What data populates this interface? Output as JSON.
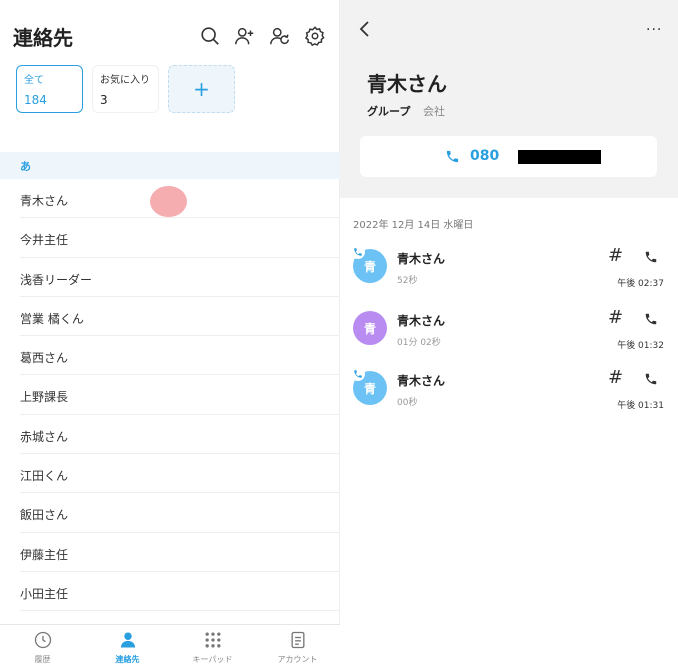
{
  "left": {
    "title": "連絡先",
    "header_icons": [
      "search-icon",
      "add-contact-icon",
      "sync-contacts-icon",
      "gear-icon"
    ],
    "cards": [
      {
        "label": "全て",
        "count": "184"
      },
      {
        "label": "お気に入り",
        "count": "3"
      },
      {
        "label": "+"
      }
    ],
    "section": "あ",
    "contacts": [
      "青木さん",
      "今井主任",
      "浅香リーダー",
      "営業 橘くん",
      "葛西さん",
      "上野課長",
      "赤城さん",
      "江田くん",
      "飯田さん",
      "伊藤主任",
      "小田主任"
    ]
  },
  "tabs": [
    {
      "label": "履歴",
      "icon": "clock-icon"
    },
    {
      "label": "連絡先",
      "icon": "person-icon"
    },
    {
      "label": "キーパッド",
      "icon": "keypad-icon"
    },
    {
      "label": "アカウント",
      "icon": "document-icon"
    }
  ],
  "detail": {
    "more": "···",
    "name": "青木さん",
    "group_label": "グループ",
    "group_value": "会社",
    "phone_prefix": "080",
    "date": "2022年 12月 14日 水曜日",
    "calls": [
      {
        "avatar": "青",
        "name": "青木さん",
        "duration": "52秒",
        "time": "午後 02:37",
        "hash": "#"
      },
      {
        "avatar": "青",
        "name": "青木さん",
        "duration": "01分 02秒",
        "time": "午後 01:32",
        "hash": "#"
      },
      {
        "avatar": "青",
        "name": "青木さん",
        "duration": "00秒",
        "time": "午後 01:31",
        "hash": "#"
      }
    ]
  },
  "colors": {
    "accent": "#2a9fe0",
    "avatar_blue": "#6cc2f5",
    "avatar_purple": "#b88cf0",
    "touch": "#f4a4a7"
  }
}
